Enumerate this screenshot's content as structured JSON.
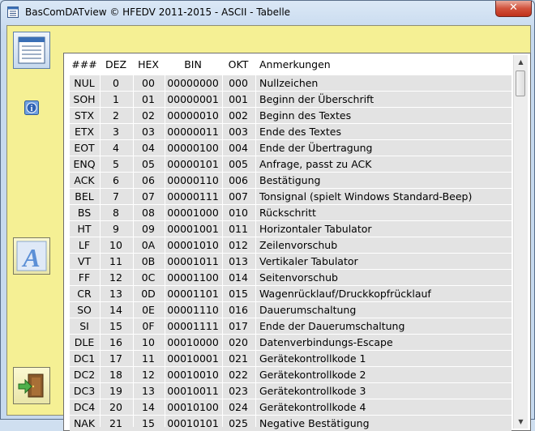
{
  "window": {
    "title": "BasComDATview © HFEDV 2011-2015 - ASCII - Tabelle",
    "close": "✕"
  },
  "colors": {
    "client_bg": "#f5f094",
    "row_bg": "#e3e3e3",
    "close_red": "#c0311b"
  },
  "sidebar": {
    "items": [
      {
        "name": "table-view-icon"
      },
      {
        "name": "info-icon",
        "glyph": "i"
      },
      {
        "name": "font-icon",
        "glyph": "A"
      },
      {
        "name": "exit-door-icon"
      }
    ]
  },
  "table": {
    "headers": [
      "###",
      "DEZ",
      "HEX",
      "BIN",
      "OKT",
      "Anmerkungen"
    ],
    "rows": [
      [
        "NUL",
        "0",
        "00",
        "00000000",
        "000",
        "Nullzeichen"
      ],
      [
        "SOH",
        "1",
        "01",
        "00000001",
        "001",
        "Beginn der Überschrift"
      ],
      [
        "STX",
        "2",
        "02",
        "00000010",
        "002",
        "Beginn des Textes"
      ],
      [
        "ETX",
        "3",
        "03",
        "00000011",
        "003",
        "Ende des Textes"
      ],
      [
        "EOT",
        "4",
        "04",
        "00000100",
        "004",
        "Ende der Übertragung"
      ],
      [
        "ENQ",
        "5",
        "05",
        "00000101",
        "005",
        "Anfrage, passt zu ACK"
      ],
      [
        "ACK",
        "6",
        "06",
        "00000110",
        "006",
        "Bestätigung"
      ],
      [
        "BEL",
        "7",
        "07",
        "00000111",
        "007",
        "Tonsignal (spielt Windows Standard-Beep)"
      ],
      [
        "BS",
        "8",
        "08",
        "00001000",
        "010",
        "Rückschritt"
      ],
      [
        "HT",
        "9",
        "09",
        "00001001",
        "011",
        "Horizontaler Tabulator"
      ],
      [
        "LF",
        "10",
        "0A",
        "00001010",
        "012",
        "Zeilenvorschub"
      ],
      [
        "VT",
        "11",
        "0B",
        "00001011",
        "013",
        "Vertikaler Tabulator"
      ],
      [
        "FF",
        "12",
        "0C",
        "00001100",
        "014",
        "Seitenvorschub"
      ],
      [
        "CR",
        "13",
        "0D",
        "00001101",
        "015",
        "Wagenrücklauf/Druckkopfrücklauf"
      ],
      [
        "SO",
        "14",
        "0E",
        "00001110",
        "016",
        "Dauerumschaltung"
      ],
      [
        "SI",
        "15",
        "0F",
        "00001111",
        "017",
        "Ende der Dauerumschaltung"
      ],
      [
        "DLE",
        "16",
        "10",
        "00010000",
        "020",
        "Datenverbindungs-Escape"
      ],
      [
        "DC1",
        "17",
        "11",
        "00010001",
        "021",
        "Gerätekontrollkode 1"
      ],
      [
        "DC2",
        "18",
        "12",
        "00010010",
        "022",
        "Gerätekontrollkode 2"
      ],
      [
        "DC3",
        "19",
        "13",
        "00010011",
        "023",
        "Gerätekontrollkode 3"
      ],
      [
        "DC4",
        "20",
        "14",
        "00010100",
        "024",
        "Gerätekontrollkode 4"
      ],
      [
        "NAK",
        "21",
        "15",
        "00010101",
        "025",
        "Negative Bestätigung"
      ]
    ]
  },
  "scrollbar": {
    "up": "▲",
    "down": "▼"
  }
}
